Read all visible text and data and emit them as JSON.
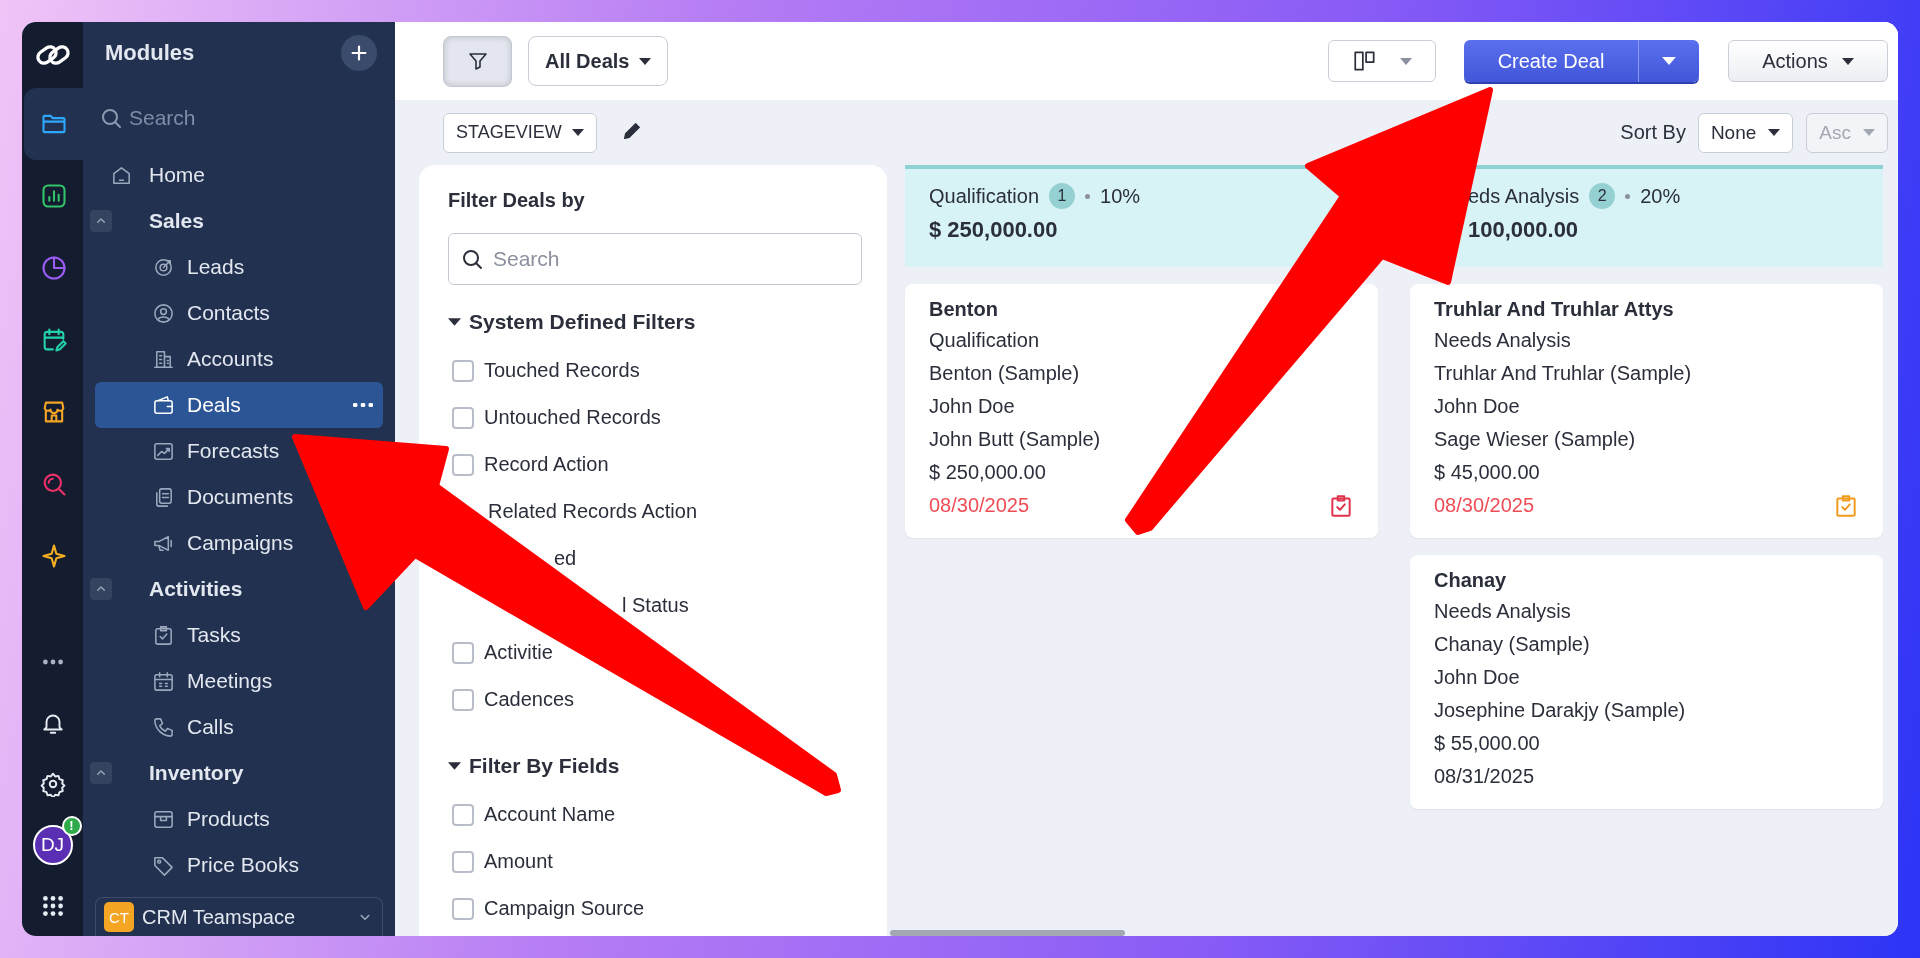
{
  "rail": {
    "items": [
      {
        "kind": "folder",
        "selected": true
      },
      {
        "kind": "analytics",
        "selected": false
      },
      {
        "kind": "pie",
        "selected": false
      },
      {
        "kind": "calendar",
        "selected": false
      },
      {
        "kind": "store",
        "selected": false
      },
      {
        "kind": "search",
        "selected": false
      },
      {
        "kind": "sparkle",
        "selected": false
      }
    ],
    "tools": [
      {
        "kind": "more"
      },
      {
        "kind": "bell"
      },
      {
        "kind": "gear"
      }
    ],
    "avatar": {
      "initials": "DJ",
      "badge": "!"
    }
  },
  "sidebar": {
    "title": "Modules",
    "search": {
      "placeholder": "Search"
    },
    "items": [
      {
        "label": "Home",
        "kind": "home",
        "selected": false
      },
      {
        "label": "Sales",
        "kind": "group",
        "expanded": true,
        "children": [
          {
            "label": "Leads",
            "kind": "target",
            "selected": false
          },
          {
            "label": "Contacts",
            "kind": "contact",
            "selected": false
          },
          {
            "label": "Accounts",
            "kind": "building",
            "selected": false
          },
          {
            "label": "Deals",
            "kind": "wallet",
            "selected": true
          },
          {
            "label": "Forecasts",
            "kind": "trend",
            "selected": false
          },
          {
            "label": "Documents",
            "kind": "docs",
            "selected": false
          },
          {
            "label": "Campaigns",
            "kind": "megaphone",
            "selected": false
          }
        ]
      },
      {
        "label": "Activities",
        "kind": "group",
        "expanded": true,
        "children": [
          {
            "label": "Tasks",
            "kind": "task",
            "selected": false
          },
          {
            "label": "Meetings",
            "kind": "calendar",
            "selected": false
          },
          {
            "label": "Calls",
            "kind": "phone",
            "selected": false
          }
        ]
      },
      {
        "label": "Inventory",
        "kind": "group",
        "expanded": true,
        "children": [
          {
            "label": "Products",
            "kind": "box",
            "selected": false
          },
          {
            "label": "Price Books",
            "kind": "tag",
            "selected": false
          }
        ]
      }
    ],
    "teamspace": {
      "badge": "CT",
      "name": "CRM Teamspace"
    }
  },
  "toolbar": {
    "view": "All Deals",
    "create": "Create Deal",
    "actions": "Actions",
    "layout": "STAGEVIEW",
    "sort_label": "Sort By",
    "sort": "None",
    "order": {
      "label": "Asc",
      "disabled": true
    }
  },
  "filter": {
    "title": "Filter Deals by",
    "search": {
      "placeholder": "Search"
    },
    "sections": [
      {
        "title": "System Defined Filters",
        "expanded": true,
        "items": [
          {
            "label": "Touched Records",
            "kind": "checkbox",
            "checked": false
          },
          {
            "label": "Untouched Records",
            "kind": "checkbox",
            "checked": false
          },
          {
            "label": "Record Action",
            "kind": "checkbox",
            "checked": false
          },
          {
            "label": "Related Records Action",
            "kind": "text"
          },
          {
            "label": "ed",
            "kind": "text"
          },
          {
            "label": "l Status",
            "kind": "text"
          },
          {
            "label": "Activitie",
            "kind": "checkbox",
            "checked": false
          },
          {
            "label": "Cadences",
            "kind": "checkbox",
            "checked": false
          }
        ]
      },
      {
        "title": "Filter By Fields",
        "expanded": true,
        "items": [
          {
            "label": "Account Name",
            "kind": "checkbox",
            "checked": false
          },
          {
            "label": "Amount",
            "kind": "checkbox",
            "checked": false
          },
          {
            "label": "Campaign Source",
            "kind": "checkbox",
            "checked": false
          }
        ]
      }
    ]
  },
  "columns": [
    {
      "title": "Qualification",
      "count": "1",
      "percent": "10%",
      "amount": "$ 250,000.00",
      "cards": [
        {
          "title": "Benton",
          "lines": [
            "Qualification",
            "Benton (Sample)",
            "John Doe",
            "John Butt (Sample)",
            "$ 250,000.00"
          ],
          "date": "08/30/2025",
          "overdue": true,
          "color": "#e0304a"
        }
      ]
    },
    {
      "title": "eds Analysis",
      "count": "2",
      "percent": "20%",
      "amount": "100,000.00",
      "cards": [
        {
          "title": "Truhlar And Truhlar Attys",
          "lines": [
            "Needs Analysis",
            "Truhlar And Truhlar (Sample)",
            "John Doe",
            "Sage Wieser (Sample)",
            "$ 45,000.00"
          ],
          "date": "08/30/2025",
          "overdue": true,
          "color": "#f29a1a"
        },
        {
          "title": "Chanay",
          "lines": [
            "Needs Analysis",
            "Chanay (Sample)",
            "John Doe",
            "Josephine Darakjy (Sample)",
            "$ 55,000.00"
          ],
          "date": "08/31/2025",
          "overdue": false
        }
      ]
    }
  ]
}
